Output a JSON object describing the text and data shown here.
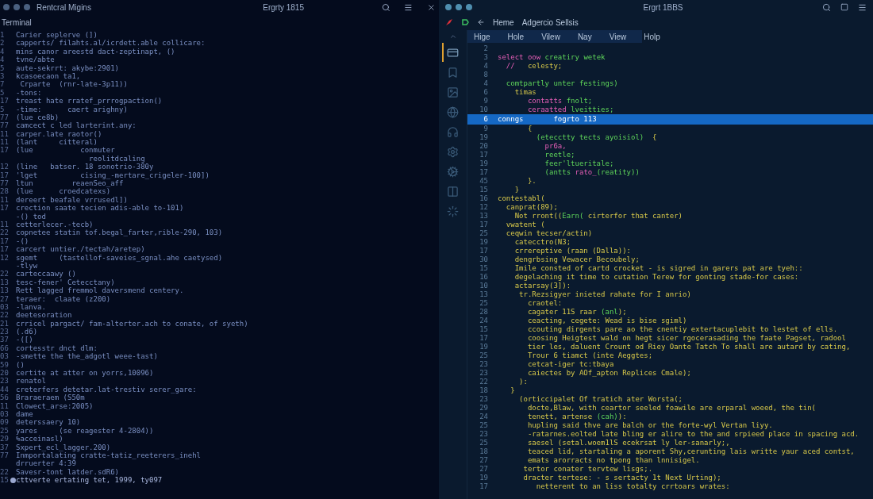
{
  "terminal": {
    "window_title": "Rentcral Migins",
    "center_title": "Ergrty 1815",
    "label": "Terminal",
    "lines": [
      {
        "number": "1",
        "text": "Carier seplerve (])",
        "marked": false
      },
      {
        "number": "2",
        "text": "capperts/ filahts.al/icrdett.able collicare:",
        "marked": false
      },
      {
        "number": "4",
        "text": "mins canor areestd dact-zeptinapt, ()",
        "marked": false
      },
      {
        "number": "4",
        "text": "tvne/abte",
        "marked": false
      },
      {
        "number": "5",
        "text": "aute-sekrrt: akybe:2901)",
        "marked": false
      },
      {
        "number": "3",
        "text": "kcasoecaon ta1,",
        "marked": false
      },
      {
        "number": "7",
        "text": " Crparte  (rnr-late-3p11))",
        "marked": false
      },
      {
        "number": "5",
        "text": "-tons:",
        "marked": false
      },
      {
        "number": "17",
        "text": "treast hate rratef_prrrogpaction()",
        "marked": false
      },
      {
        "number": "5",
        "text": "-time:      caert arighny)",
        "marked": false
      },
      {
        "number": "77",
        "text": "(lue ce8b)",
        "marked": false
      },
      {
        "number": "77",
        "text": "camcect c led larterint.any:",
        "marked": false
      },
      {
        "number": "11",
        "text": "carper.late raotor()",
        "marked": false
      },
      {
        "number": "11",
        "text": "(lant     citteral)",
        "marked": false
      },
      {
        "number": "17",
        "text": "(lue           conmuter",
        "marked": false
      },
      {
        "text": "                 reolitdcaling",
        "marked": false
      },
      {
        "number": "12",
        "text": "(line   batser. 18 sonotrio-380y",
        "marked": false
      },
      {
        "number": "17",
        "text": "'lget          cising_-mertare_crigeler-100])",
        "marked": false
      },
      {
        "number": "77",
        "text": "ltun         reaenSeo_aff",
        "marked": false
      },
      {
        "number": "28",
        "text": "(lue      croedcatexs)",
        "marked": false
      },
      {
        "number": "11",
        "text": "dereert beafale vrrusedl])",
        "marked": false
      },
      {
        "number": "17",
        "text": "crection saate tecien adis-able to-101)",
        "marked": false
      },
      {
        "text": "-() tod",
        "marked": false
      },
      {
        "number": "11",
        "text": "cetterlecer.-tecb)",
        "marked": false
      },
      {
        "number": "22",
        "text": "copnetee statin tof.begal_farter,rible-290, 103)",
        "marked": false
      },
      {
        "number": "17",
        "text": "-()",
        "marked": false
      },
      {
        "number": "17",
        "text": "carcert untier./tectah/aretep)",
        "marked": false
      },
      {
        "number": "12",
        "text": "sgemt     (tastellof-saveies_sgnal.ahe caetysed)",
        "marked": false
      },
      {
        "text": "-tlyw",
        "marked": false
      },
      {
        "number": "22",
        "text": "carteccaawy ()",
        "marked": false
      },
      {
        "number": "13",
        "text": "tesc-fener' Cetecctany)",
        "marked": false
      },
      {
        "number": "13",
        "text": "Rett lagged fremmol daversmend centery.",
        "marked": false
      },
      {
        "number": "27",
        "text": "teraer:  claate (z200)",
        "marked": false
      },
      {
        "number": "03",
        "text": "-lanva.",
        "marked": false
      },
      {
        "number": "22",
        "text": "deetesoration",
        "marked": false
      },
      {
        "number": "21",
        "text": "crricel pargact/ fam-alterter.ach to conate, of syeth)",
        "marked": false
      },
      {
        "number": "23",
        "text": "(.d6)",
        "marked": false
      },
      {
        "number": "37",
        "text": "-([)",
        "marked": false
      },
      {
        "number": "66",
        "text": "cortesstr dnct dlm:",
        "marked": false
      },
      {
        "number": "03",
        "text": "-smette the the_adgotl weee-tast)",
        "marked": false
      },
      {
        "number": "59",
        "text": "()",
        "marked": false
      },
      {
        "number": "20",
        "text": "certite at atter on yorrs,10096)",
        "marked": false
      },
      {
        "number": "23",
        "text": "renatol",
        "marked": false
      },
      {
        "number": "44",
        "text": "creterfers detetar.lat-trestiv serer_gare:",
        "marked": false
      },
      {
        "number": "56",
        "text": "Braraeraem (S50m",
        "marked": false
      },
      {
        "number": "11",
        "text": "Clowect_arse:2005)",
        "marked": false
      },
      {
        "number": "03",
        "text": "dame",
        "marked": false
      },
      {
        "number": "09",
        "text": "deterssaery 10)",
        "marked": false
      },
      {
        "number": "25",
        "text": "yares     (se reagester 4-2804))",
        "marked": false
      },
      {
        "number": "29",
        "text": "%acceinasl)",
        "marked": false
      },
      {
        "number": "37",
        "text": "Sxpert_ecl_lagger.200)",
        "marked": false
      },
      {
        "number": "77",
        "text": "Inmportalating cratte-tatiz_reeterers_inehl",
        "marked": false
      },
      {
        "text": "drruerter 4:39",
        "marked": false
      },
      {
        "number": "22",
        "text": "Savesr-tont latder.sdR6)",
        "marked": false
      },
      {
        "number": "15",
        "text": "cttverte ertating tet, 1999, ty097",
        "marked": true
      }
    ]
  },
  "editor": {
    "center_title": "Ergrt 1BBS",
    "breadcrumbs": [
      "Heme",
      "Adgercio Sellsis"
    ],
    "menu": [
      "Hige",
      "Hole",
      "Vilew",
      "Nay",
      "View",
      "Holp"
    ],
    "activity": [
      {
        "kind": "card",
        "selected": true
      },
      {
        "kind": "bookmark",
        "selected": false
      },
      {
        "kind": "image",
        "selected": false
      },
      {
        "kind": "globe",
        "selected": false
      },
      {
        "kind": "headphones",
        "selected": false
      },
      {
        "kind": "gear",
        "selected": false
      },
      {
        "kind": "cog",
        "selected": false
      },
      {
        "kind": "columns",
        "selected": false
      },
      {
        "kind": "loader",
        "selected": false
      }
    ],
    "lines": [
      {
        "number": "2",
        "selected": false
      },
      {
        "number": "3",
        "selected": false,
        "segments": [
          {
            "text": "select oow ",
            "kind": "keyword"
          },
          {
            "text": "creatiry wetek",
            "kind": "name"
          }
        ]
      },
      {
        "number": "4",
        "selected": false,
        "segments": [
          {
            "text": "  //   ",
            "kind": "keyword"
          },
          {
            "text": "celesty;",
            "kind": "plain"
          }
        ]
      },
      {
        "number": "8",
        "selected": false
      },
      {
        "number": "4",
        "selected": false,
        "segments": [
          {
            "text": "  comtpartly unter festings)",
            "kind": "name"
          }
        ]
      },
      {
        "number": "6",
        "selected": false,
        "segments": [
          {
            "text": "    timas",
            "kind": "plain"
          }
        ]
      },
      {
        "number": "9",
        "selected": false,
        "segments": [
          {
            "text": "       contatts ",
            "kind": "keyword"
          },
          {
            "text": "fnolt;",
            "kind": "name"
          }
        ]
      },
      {
        "number": "10",
        "selected": false,
        "segments": [
          {
            "text": "       ceraatted ",
            "kind": "keyword"
          },
          {
            "text": "lveitties;",
            "kind": "name"
          }
        ]
      },
      {
        "number": "6",
        "selected": true,
        "segments": [
          {
            "text": "conngs       fogrto 113"
          }
        ]
      },
      {
        "number": "9",
        "selected": false,
        "segments": [
          {
            "text": "       {",
            "kind": "plain"
          }
        ]
      },
      {
        "number": "19",
        "selected": false,
        "segments": [
          {
            "text": "         (etecctty tects ayoisiol)  ",
            "kind": "name"
          },
          {
            "text": "{",
            "kind": "plain"
          }
        ]
      },
      {
        "number": "20",
        "selected": false,
        "segments": [
          {
            "text": "           pr6a,",
            "kind": "keyword"
          }
        ]
      },
      {
        "number": "17",
        "selected": false,
        "segments": [
          {
            "text": "           reetle;",
            "kind": "name"
          }
        ]
      },
      {
        "number": "19",
        "selected": false,
        "segments": [
          {
            "text": "           feer'ltueritale;",
            "kind": "name"
          }
        ]
      },
      {
        "number": "17",
        "selected": false,
        "segments": [
          {
            "text": "           (antts ",
            "kind": "name"
          },
          {
            "text": "rato_",
            "kind": "keyword"
          },
          {
            "text": "(reatity))",
            "kind": "name"
          }
        ]
      },
      {
        "number": "45",
        "selected": false,
        "segments": [
          {
            "text": "       }.",
            "kind": "plain"
          }
        ]
      },
      {
        "number": "15",
        "selected": false,
        "segments": [
          {
            "text": "    }",
            "kind": "plain"
          }
        ]
      },
      {
        "number": "16",
        "selected": false,
        "segments": [
          {
            "text": "contestabl(",
            "kind": "plain"
          }
        ]
      },
      {
        "number": "12",
        "selected": false,
        "segments": [
          {
            "text": "  canprat(89);",
            "kind": "plain"
          }
        ]
      },
      {
        "number": "13",
        "selected": false,
        "segments": [
          {
            "text": "    Not rront((",
            "kind": "plain"
          },
          {
            "text": "Earn(",
            "kind": "name"
          },
          {
            "text": " cirterfor that canter)",
            "kind": "plain"
          }
        ]
      },
      {
        "number": "17",
        "selected": false,
        "segments": [
          {
            "text": "  vwatent (",
            "kind": "plain"
          }
        ]
      },
      {
        "number": "25",
        "selected": false,
        "segments": [
          {
            "text": "  ceqwin tecser/actin)",
            "kind": "plain"
          }
        ]
      },
      {
        "number": "19",
        "selected": false,
        "segments": [
          {
            "text": "    catecctro(N3;",
            "kind": "plain"
          }
        ]
      },
      {
        "number": "17",
        "selected": false,
        "segments": [
          {
            "text": "    crrereptive (raan (Dalla)):",
            "kind": "plain"
          }
        ]
      },
      {
        "number": "30",
        "selected": false,
        "segments": [
          {
            "text": "    dengrbsing Vewacer Becoubely;",
            "kind": "plain"
          }
        ]
      },
      {
        "number": "15",
        "selected": false,
        "segments": [
          {
            "text": "    Imile consted of cartd crocket - is sigred in garers pat are tyeh::",
            "kind": "plain"
          }
        ]
      },
      {
        "number": "16",
        "selected": false,
        "segments": [
          {
            "text": "    degelaching it time to cutation Terew for gonting stade-for cases:",
            "kind": "plain"
          }
        ]
      },
      {
        "number": "10",
        "selected": false,
        "segments": [
          {
            "text": "    actarsay(3]):",
            "kind": "plain"
          }
        ]
      },
      {
        "number": "13",
        "selected": false,
        "segments": [
          {
            "text": "     tr.Rezsigyer inieted rahate for I anrio)",
            "kind": "plain"
          }
        ]
      },
      {
        "number": "25",
        "selected": false,
        "segments": [
          {
            "text": "       craotel:",
            "kind": "plain"
          }
        ]
      },
      {
        "number": "28",
        "selected": false,
        "segments": [
          {
            "text": "       cagater 11S raar ",
            "kind": "plain"
          },
          {
            "text": "(anl",
            "kind": "name"
          },
          {
            "text": ");",
            "kind": "plain"
          }
        ]
      },
      {
        "number": "24",
        "selected": false,
        "segments": [
          {
            "text": "       ceacting, cegete: Wead is bise sgiml)",
            "kind": "plain"
          }
        ]
      },
      {
        "number": "15",
        "selected": false,
        "segments": [
          {
            "text": "       ccouting dirgents pare ao the cnentiy extertacuplebit to lestet of ells.",
            "kind": "plain"
          }
        ]
      },
      {
        "number": "17",
        "selected": false,
        "segments": [
          {
            "text": "       coosing Heigtest wald on hegt sicer rgocerasading the faate Pagset, radool",
            "kind": "plain"
          }
        ]
      },
      {
        "number": "19",
        "selected": false,
        "segments": [
          {
            "text": "       tier les, daluent Crount od Riey Oante Tatch To shall are autard by cating,",
            "kind": "plain"
          }
        ]
      },
      {
        "number": "25",
        "selected": false,
        "segments": [
          {
            "text": "       Trour 6 tiamct (inte Aeggtes;",
            "kind": "plain"
          }
        ]
      },
      {
        "number": "23",
        "selected": false,
        "segments": [
          {
            "text": "       cetcat-iger tc:tbaya",
            "kind": "plain"
          }
        ]
      },
      {
        "number": "23",
        "selected": false,
        "segments": [
          {
            "text": "       caiectes by AOf_apton Replices Cmale);",
            "kind": "plain"
          }
        ]
      },
      {
        "number": "22",
        "selected": false,
        "segments": [
          {
            "text": "     ):",
            "kind": "plain"
          }
        ]
      },
      {
        "number": "18",
        "selected": false,
        "segments": [
          {
            "text": "   }",
            "kind": "plain"
          }
        ]
      },
      {
        "number": "23",
        "selected": false,
        "segments": [
          {
            "text": "     (orticcipalet Of tratich ater Worsta(;",
            "kind": "plain"
          }
        ]
      },
      {
        "number": "29",
        "selected": false,
        "segments": [
          {
            "text": "       docte,Blaw, with ceartor seeled foawile are erparal woeed, the tin(",
            "kind": "plain"
          }
        ]
      },
      {
        "number": "24",
        "selected": false,
        "segments": [
          {
            "text": "       tenett, artense ",
            "kind": "plain"
          },
          {
            "text": "(cah)",
            "kind": "name"
          },
          {
            "text": "):",
            "kind": "plain"
          }
        ]
      },
      {
        "number": "25",
        "selected": false,
        "segments": [
          {
            "text": "       hupling said thve are balch or the forte-wyl Vertan liyy.",
            "kind": "plain"
          }
        ]
      },
      {
        "number": "23",
        "selected": false,
        "segments": [
          {
            "text": "       -ratarnes.eolted late bling er alire to the and srpieed place in spacing acd.",
            "kind": "plain"
          }
        ]
      },
      {
        "number": "25",
        "selected": false,
        "segments": [
          {
            "text": "       saesel (setal.woem1lS ecekrsat ly ler-sanarly;,",
            "kind": "plain"
          }
        ]
      },
      {
        "number": "18",
        "selected": false,
        "segments": [
          {
            "text": "       teaced lid, startaling a aporent Shy,cerunting lais writte yaur aced contst,",
            "kind": "plain"
          }
        ]
      },
      {
        "number": "27",
        "selected": false,
        "segments": [
          {
            "text": "       emats arorracts no tpong than lnnisigel.",
            "kind": "plain"
          }
        ]
      },
      {
        "number": "27",
        "selected": false,
        "segments": [
          {
            "text": "      tertor conater tervtew lisgs;.",
            "kind": "plain"
          }
        ]
      },
      {
        "number": "19",
        "selected": false,
        "segments": [
          {
            "text": "      dracter tertese: - s sertacty 1t Next Urting);",
            "kind": "plain"
          }
        ]
      },
      {
        "number": "17",
        "selected": false,
        "segments": [
          {
            "text": "         netterent to an liss totalty crrtoars wrates:",
            "kind": "plain"
          }
        ]
      }
    ]
  }
}
